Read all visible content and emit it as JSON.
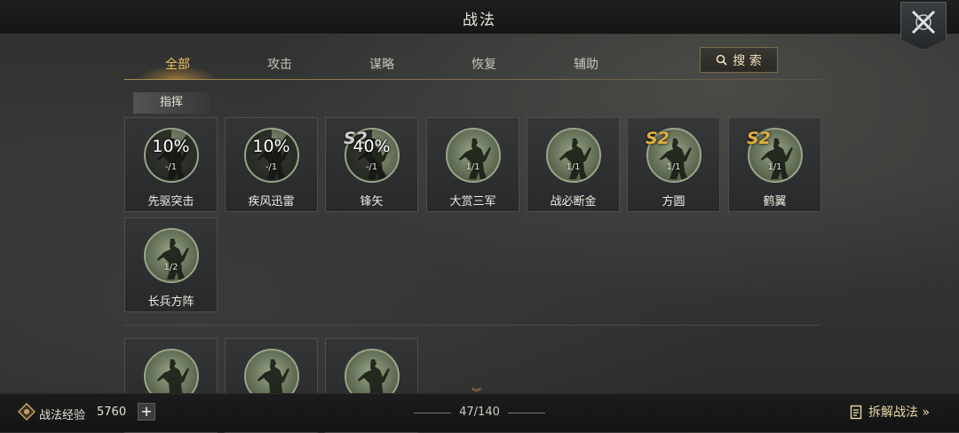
{
  "header": {
    "title": "战法"
  },
  "tabs": [
    {
      "label": "全部",
      "active": true
    },
    {
      "label": "攻击",
      "active": false
    },
    {
      "label": "谋略",
      "active": false
    },
    {
      "label": "恢复",
      "active": false
    },
    {
      "label": "辅助",
      "active": false
    }
  ],
  "search": {
    "label": "搜 索"
  },
  "section": {
    "label": "指挥"
  },
  "cards": [
    {
      "name": "先驱突击",
      "percent": "10%",
      "count": "-/1",
      "badge": "",
      "cooldown": 0.1
    },
    {
      "name": "疾风迅雷",
      "percent": "10%",
      "count": "-/1",
      "badge": "",
      "cooldown": 0.1
    },
    {
      "name": "锋矢",
      "percent": "40%",
      "count": "-/1",
      "badge": "S2",
      "badge_color": "#d0d0cc",
      "cooldown": 0.4
    },
    {
      "name": "大赏三军",
      "percent": "",
      "count": "1/1",
      "badge": ""
    },
    {
      "name": "战必断金",
      "percent": "",
      "count": "1/1",
      "badge": ""
    },
    {
      "name": "方圆",
      "percent": "",
      "count": "1/1",
      "badge": "S2",
      "badge_color": "#e0b040"
    },
    {
      "name": "鹤翼",
      "percent": "",
      "count": "1/1",
      "badge": "S2",
      "badge_color": "#e0b040"
    },
    {
      "name": "长兵方阵",
      "percent": "",
      "count": "1/2",
      "badge": ""
    }
  ],
  "footer": {
    "exp_label": "战法经验",
    "exp_value": "5760",
    "plus": "+",
    "page": "47/140",
    "dismantle": "拆解战法 »"
  },
  "colors": {
    "accent": "#f0c060",
    "text": "#e8e3d7"
  }
}
